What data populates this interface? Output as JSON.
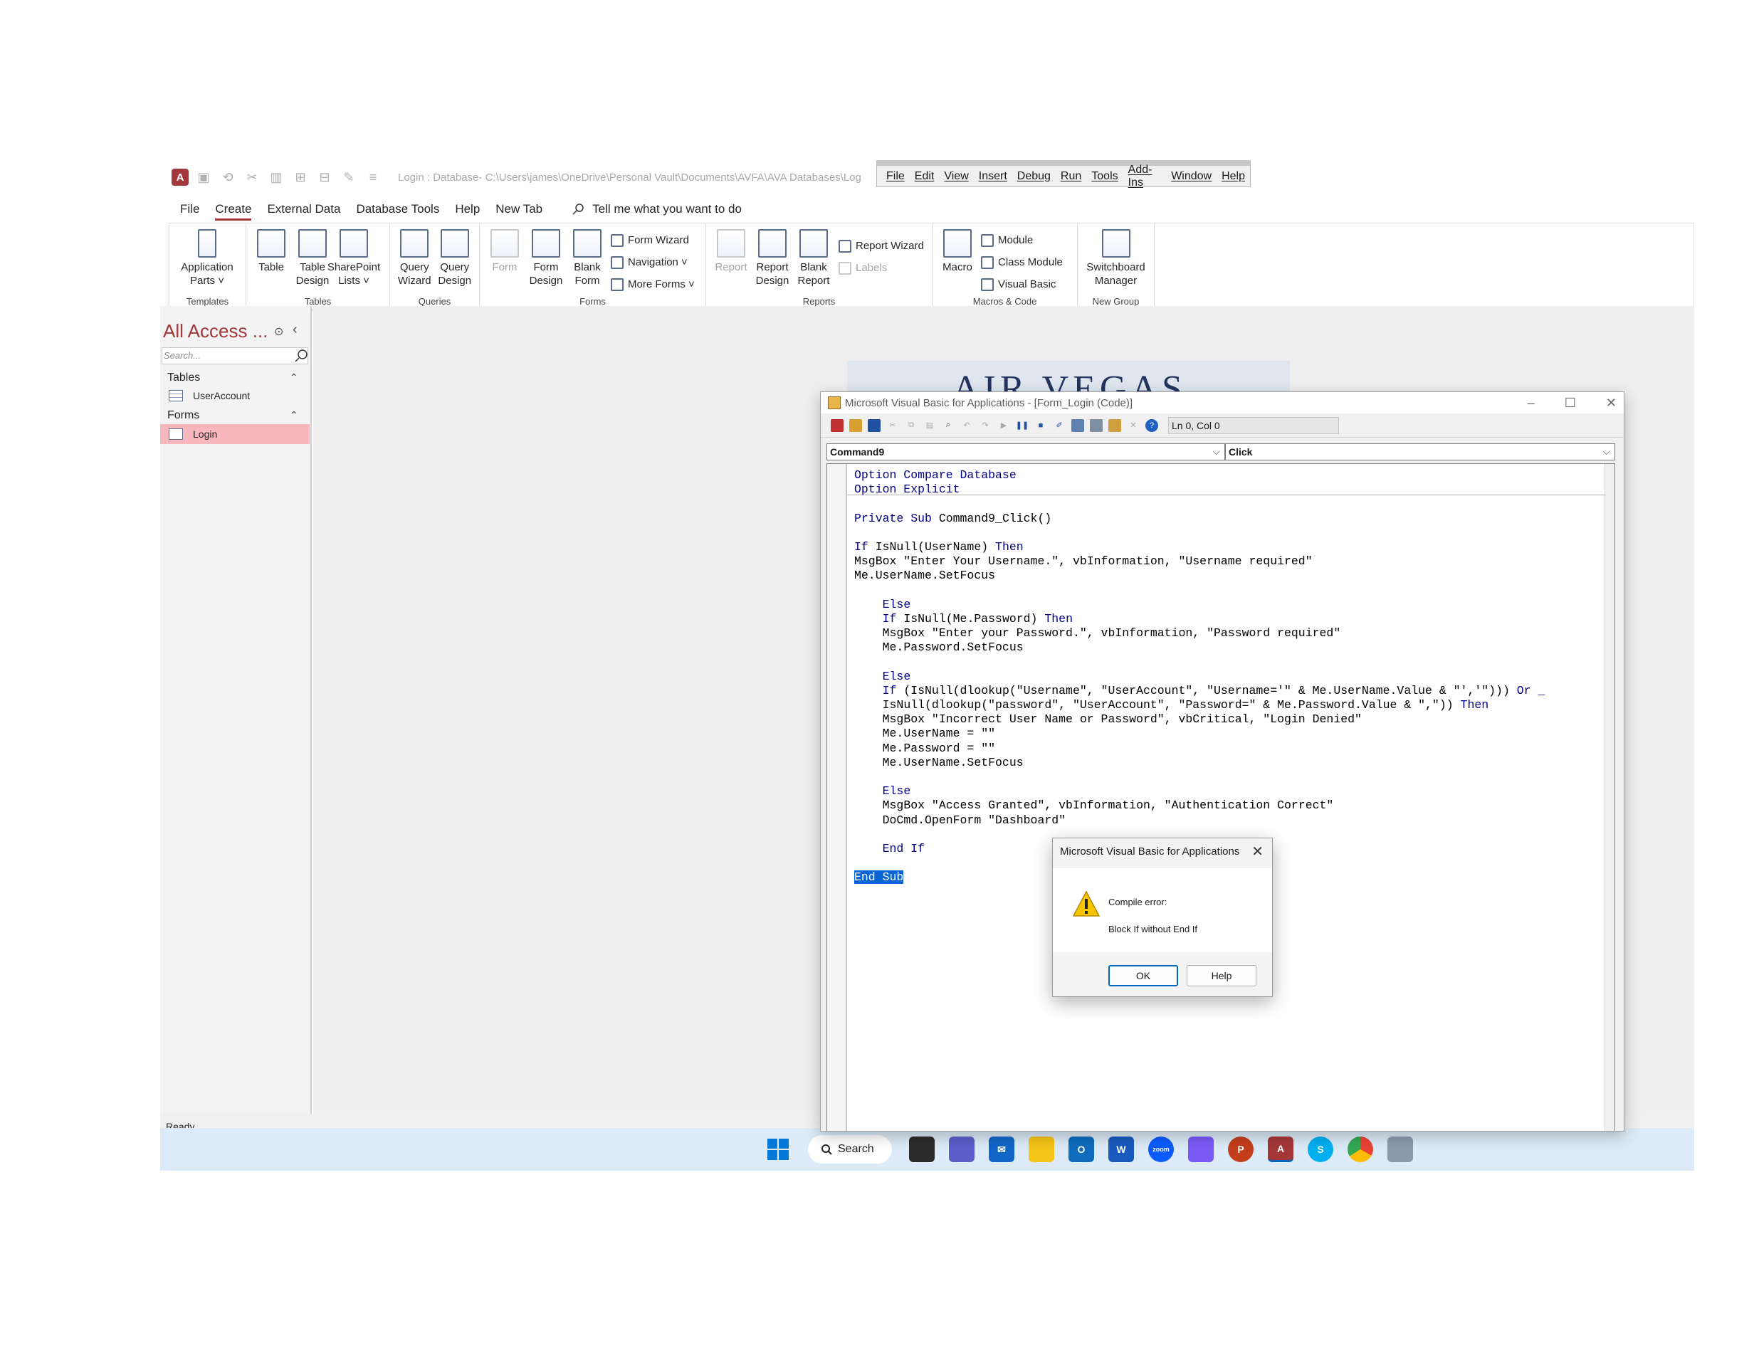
{
  "access": {
    "title": "Login : Database- C:\\Users\\james\\OneDrive\\Personal Vault\\Documents\\AVFA\\AVA Databases\\Login",
    "tabs": [
      "File",
      "Create",
      "External Data",
      "Database Tools",
      "Help",
      "New Tab"
    ],
    "active_tab": "Create",
    "tell_me": "Tell me what you want to do",
    "ribbon": {
      "templates": {
        "label": "Templates",
        "app_parts": "Application Parts ˅"
      },
      "tables": {
        "label": "Tables",
        "table": "Table",
        "table_design": "Table Design",
        "sharepoint": "SharePoint Lists ˅"
      },
      "queries": {
        "label": "Queries",
        "query_wizard": "Query Wizard",
        "query_design": "Query Design"
      },
      "forms": {
        "label": "Forms",
        "form": "Form",
        "form_design": "Form Design",
        "blank_form": "Blank Form",
        "form_wizard": "Form Wizard",
        "navigation": "Navigation ˅",
        "more_forms": "More Forms ˅"
      },
      "reports": {
        "label": "Reports",
        "report": "Report",
        "report_design": "Report Design",
        "blank_report": "Blank Report",
        "report_wizard": "Report Wizard",
        "labels": "Labels"
      },
      "macros": {
        "label": "Macros & Code",
        "macro": "Macro",
        "module": "Module",
        "class_module": "Class Module",
        "visual_basic": "Visual Basic"
      },
      "newgroup": {
        "label": "New Group",
        "switchboard": "Switchboard Manager"
      }
    },
    "nav": {
      "title": "All Access ...",
      "search_placeholder": "Search...",
      "tables_header": "Tables",
      "tables": [
        "UserAccount"
      ],
      "forms_header": "Forms",
      "forms": [
        "Login"
      ]
    },
    "status": "Ready",
    "form_banner": "AIR VEGAS"
  },
  "vbe_menu": [
    "File",
    "Edit",
    "View",
    "Insert",
    "Debug",
    "Run",
    "Tools",
    "Add-Ins",
    "Window",
    "Help"
  ],
  "vba": {
    "title": "Microsoft Visual Basic for Applications - [Form_Login (Code)]",
    "position": "Ln 0, Col 0",
    "object_combo": "Command9",
    "proc_combo": "Click",
    "code": [
      "Option Compare Database",
      "Option Explicit",
      "",
      "Private Sub Command9_Click()",
      "",
      "If IsNull(UserName) Then",
      "MsgBox \"Enter Your Username.\", vbInformation, \"Username required\"",
      "Me.UserName.SetFocus",
      "",
      "    Else",
      "    If IsNull(Me.Password) Then",
      "    MsgBox \"Enter your Password.\", vbInformation, \"Password required\"",
      "    Me.Password.SetFocus",
      "",
      "    Else",
      "    If (IsNull(dlookup(\"Username\", \"UserAccount\", \"Username='\" & Me.UserName.Value & \"','\"))) Or _",
      "    IsNull(dlookup(\"password\", \"UserAccount\", \"Password=\" & Me.Password.Value & \",\")) Then",
      "    MsgBox \"Incorrect User Name or Password\", vbCritical, \"Login Denied\"",
      "    Me.UserName = \"\"",
      "    Me.Password = \"\"",
      "    Me.UserName.SetFocus",
      "",
      "    Else",
      "    MsgBox \"Access Granted\", vbInformation, \"Authentication Correct\"",
      "    DoCmd.OpenForm \"Dashboard\"",
      "",
      "    End If",
      "",
      "End Sub"
    ]
  },
  "dialog": {
    "title": "Microsoft Visual Basic for Applications",
    "line1": "Compile error:",
    "line2": "Block If without End If",
    "ok": "OK",
    "help": "Help"
  },
  "taskbar": {
    "search": "Search"
  },
  "colors": {
    "access_accent": "#a4373a",
    "vba_keyword": "#00008b",
    "selection": "#0a64d6",
    "nav_selected": "#f8b7bd"
  }
}
